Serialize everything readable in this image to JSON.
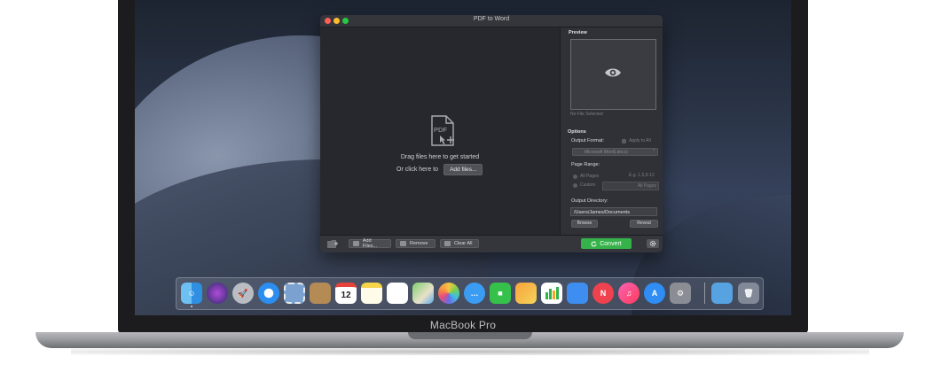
{
  "laptop": {
    "label": "MacBook Pro"
  },
  "window": {
    "title": "PDF to Word",
    "drop_area": {
      "icon_label": "PDF",
      "drag_text": "Drag files here to get started",
      "click_text": "Or click here to",
      "add_button": "Add files..."
    },
    "preview": {
      "title": "Preview",
      "no_file": "No File Selected"
    },
    "options": {
      "title": "Options",
      "output_format_label": "Output Format:",
      "apply_to_all": "Apply to All",
      "format_value": "Microsoft Word(.docx)",
      "page_range_label": "Page Range:",
      "all_pages": "All Pages",
      "range_hint": "E.g. 1,5,9-12",
      "custom": "Custom",
      "custom_value": "All Pages",
      "output_directory_label": "Output Directory:",
      "output_directory": "/Users/James/Documents",
      "browse": "Browse",
      "reveal": "Reveal"
    },
    "toolbar": {
      "add_files": "Add Files...",
      "remove": "Remove",
      "clear_all": "Clear All",
      "convert": "Convert"
    }
  },
  "dock": {
    "calendar_day": "12",
    "apps": [
      "finder-icon",
      "siri-icon",
      "launchpad-icon",
      "safari-icon",
      "mail-stamp-icon",
      "contacts-icon",
      "calendar-icon",
      "notes-icon",
      "reminders-icon",
      "maps-icon",
      "photos-icon",
      "messages-icon",
      "facetime-icon",
      "pages-icon",
      "numbers-icon",
      "keynote-icon",
      "news-icon",
      "itunes-icon",
      "app-store-icon",
      "system-preferences-icon",
      "downloads-folder-icon",
      "trash-icon"
    ]
  },
  "colors": {
    "convert_green": "#35b24a",
    "window_bg": "#26282d",
    "sidebar_bg": "#2f3136"
  }
}
